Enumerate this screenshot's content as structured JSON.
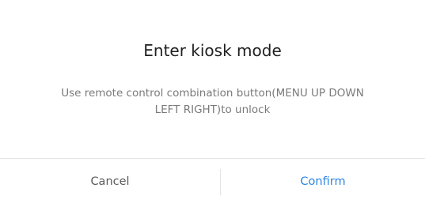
{
  "dialog": {
    "title": "Enter kiosk mode",
    "message": "Use remote control combination button(MENU UP DOWN LEFT RIGHT)to unlock",
    "buttons": {
      "cancel": "Cancel",
      "confirm": "Confirm"
    },
    "colors": {
      "confirm_accent": "#2e86e6",
      "title_text": "#1f1f1f",
      "message_text": "#7a7a7a",
      "divider": "#e3e3e3"
    }
  }
}
